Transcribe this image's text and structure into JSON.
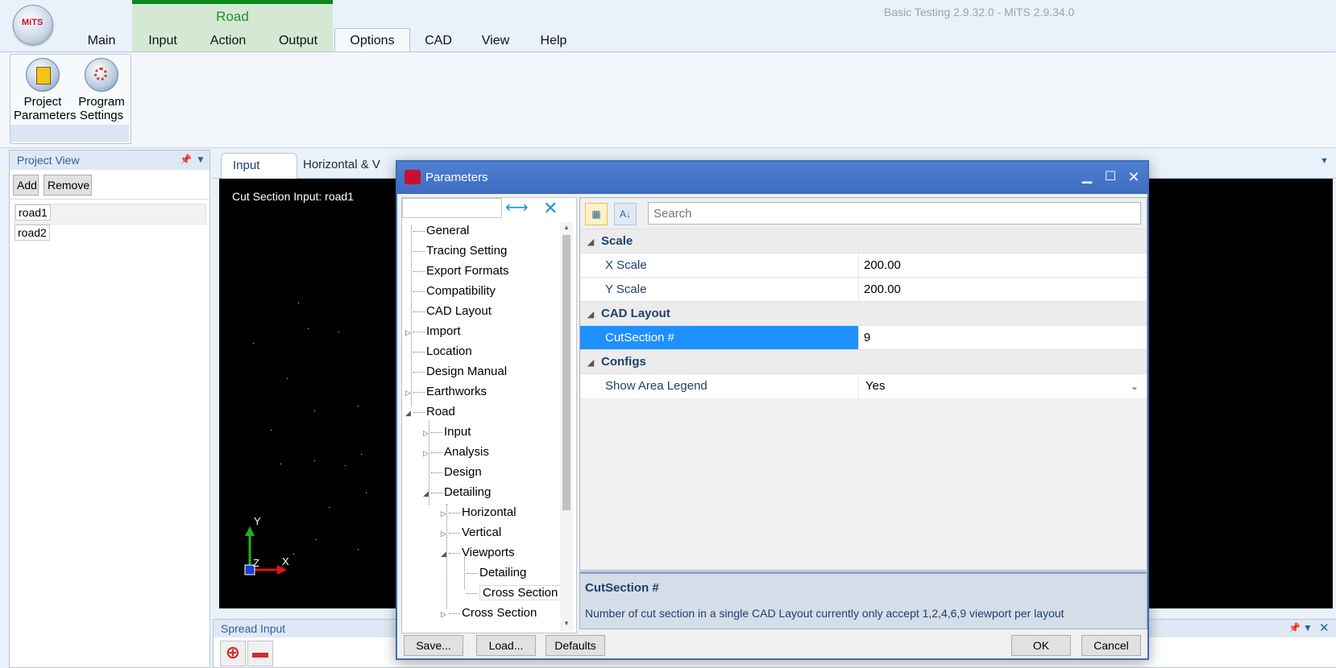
{
  "app": {
    "title": "Basic Testing 2.9.32.0 - MiTS 2.9.34.0",
    "logo_text": "MiTS",
    "context_group": "Road"
  },
  "ribbon": {
    "tabs": [
      {
        "label": "Main"
      },
      {
        "label": "Input"
      },
      {
        "label": "Action"
      },
      {
        "label": "Output"
      },
      {
        "label": "Options"
      },
      {
        "label": "CAD"
      },
      {
        "label": "View"
      },
      {
        "label": "Help"
      }
    ],
    "active_tab": "Options",
    "buttons": [
      {
        "line1": "Project",
        "line2": "Parameters",
        "icon": "project-parameters-icon"
      },
      {
        "line1": "Program",
        "line2": "Settings",
        "icon": "program-settings-icon"
      }
    ]
  },
  "project_view": {
    "title": "Project View",
    "add_label": "Add",
    "remove_label": "Remove",
    "items": [
      "road1",
      "road2"
    ]
  },
  "documents": {
    "tabs": [
      "Input",
      "Horizontal & V"
    ],
    "canvas_label": "Cut Section Input: road1",
    "axis": {
      "y": "Y",
      "z": "Z",
      "x": "X"
    }
  },
  "spread_input": {
    "title": "Spread Input"
  },
  "dialog": {
    "title": "Parameters",
    "tree": {
      "search_value": "",
      "nodes": [
        {
          "label": "General",
          "level": 0,
          "expander": ""
        },
        {
          "label": "Tracing Setting",
          "level": 0,
          "expander": ""
        },
        {
          "label": "Export Formats",
          "level": 0,
          "expander": ""
        },
        {
          "label": "Compatibility",
          "level": 0,
          "expander": ""
        },
        {
          "label": "CAD Layout",
          "level": 0,
          "expander": ""
        },
        {
          "label": "Import",
          "level": 0,
          "expander": "▷"
        },
        {
          "label": "Location",
          "level": 0,
          "expander": ""
        },
        {
          "label": "Design Manual",
          "level": 0,
          "expander": ""
        },
        {
          "label": "Earthworks",
          "level": 0,
          "expander": "▷"
        },
        {
          "label": "Road",
          "level": 0,
          "expander": "◢"
        },
        {
          "label": "Input",
          "level": 1,
          "expander": "▷"
        },
        {
          "label": "Analysis",
          "level": 1,
          "expander": "▷"
        },
        {
          "label": "Design",
          "level": 1,
          "expander": ""
        },
        {
          "label": "Detailing",
          "level": 1,
          "expander": "◢"
        },
        {
          "label": "Horizontal",
          "level": 2,
          "expander": "▷"
        },
        {
          "label": "Vertical",
          "level": 2,
          "expander": "▷"
        },
        {
          "label": "Viewports",
          "level": 2,
          "expander": "◢"
        },
        {
          "label": "Detailing",
          "level": 3,
          "expander": ""
        },
        {
          "label": "Cross Section",
          "level": 3,
          "expander": "",
          "selected": true
        },
        {
          "label": "Cross Section",
          "level": 2,
          "expander": "▷"
        }
      ]
    },
    "properties": {
      "search_placeholder": "Search",
      "categories": [
        {
          "name": "Scale",
          "rows": [
            {
              "name": "X Scale",
              "value": "200.00"
            },
            {
              "name": "Y Scale",
              "value": "200.00"
            }
          ]
        },
        {
          "name": "CAD Layout",
          "rows": [
            {
              "name": "CutSection #",
              "value": "9",
              "selected": true
            }
          ]
        },
        {
          "name": "Configs",
          "rows": [
            {
              "name": "Show Area Legend",
              "value": "Yes",
              "dropdown": true
            }
          ]
        }
      ]
    },
    "description": {
      "title": "CutSection #",
      "text": "Number of cut section in a single CAD Layout currently only accept 1,2,4,6,9 viewport per layout"
    },
    "buttons": {
      "save": "Save...",
      "load": "Load...",
      "defaults": "Defaults",
      "ok": "OK",
      "cancel": "Cancel"
    }
  },
  "colors": {
    "accent": "#4a7bd0",
    "context_green": "#0a8a1e",
    "selection": "#1e90ff"
  }
}
